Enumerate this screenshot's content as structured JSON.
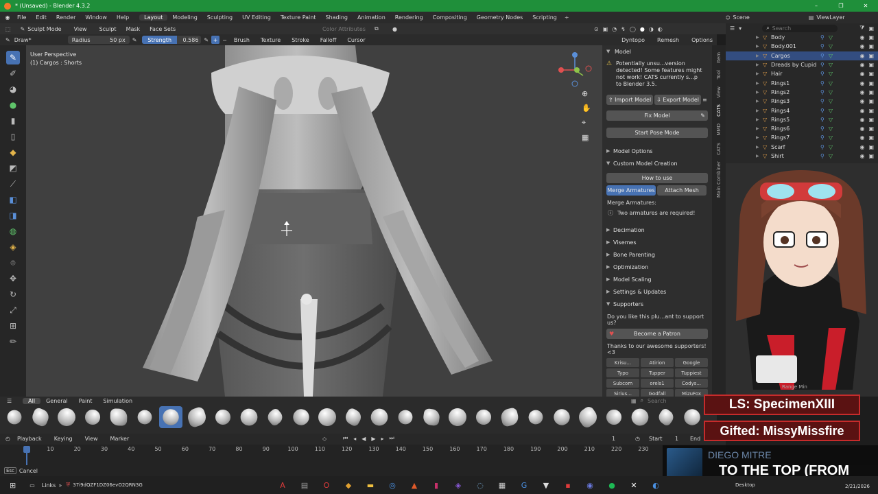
{
  "window": {
    "title": "* (Unsaved) - Blender 4.3.2",
    "controls": [
      "–",
      "❐",
      "✕"
    ]
  },
  "menu": [
    "File",
    "Edit",
    "Render",
    "Window",
    "Help"
  ],
  "workspaces": [
    "Layout",
    "Modeling",
    "Sculpting",
    "UV Editing",
    "Texture Paint",
    "Shading",
    "Animation",
    "Rendering",
    "Compositing",
    "Geometry Nodes",
    "Scripting"
  ],
  "scene": {
    "label": "Scene",
    "viewlayer": "ViewLayer"
  },
  "viewport_header": {
    "mode": "Sculpt Mode",
    "items": [
      "View",
      "Sculpt",
      "Mask",
      "Face Sets"
    ],
    "color_attributes": "Color Attributes"
  },
  "tool_settings": {
    "brush": "Draw*",
    "radius_label": "Radius",
    "radius_value": "50 px",
    "strength_label": "Strength",
    "strength_value": "0.586",
    "strength_fraction": 0.586,
    "menus": [
      "Brush",
      "Texture",
      "Stroke",
      "Falloff",
      "Cursor"
    ],
    "right": [
      "Dyntopo",
      "Remesh",
      "Options"
    ]
  },
  "viewport_info": {
    "line1": "User Perspective",
    "line2": "(1) Cargos : Shorts"
  },
  "axes": [
    "X",
    "Y",
    "Z"
  ],
  "sidebar_tabs": [
    "Item",
    "Tool",
    "View",
    "CATS",
    "MMD",
    "CATS",
    "Main Combiner"
  ],
  "cats_panel": {
    "header": "Model",
    "warning": "Potentially unsu...version detected! Some features might not work! CATS currently s...p to Blender 3.5.",
    "import_model": "Import Model",
    "export_model": "Export Model",
    "fix_model": "Fix Model",
    "start_pose_mode": "Start Pose Mode",
    "model_options": "Model Options",
    "custom_model_creation": "Custom Model Creation",
    "how_to_use": "How to use",
    "merge_armatures": "Merge Armatures",
    "attach_mesh": "Attach Mesh",
    "merge_armatures_label": "Merge Armatures:",
    "two_armatures": "Two armatures are required!",
    "sections": [
      "Decimation",
      "Visemes",
      "Bone Parenting",
      "Optimization",
      "Model Scaling",
      "Settings & Updates"
    ],
    "supporters": "Supporters",
    "support_question": "Do you like this plu...ant to support us?",
    "become_patron": "Become a Patron",
    "thanks": "Thanks to our awesome supporters! <3",
    "supporter_names": [
      "Krisu...",
      "Atirion",
      "Google",
      "Typo",
      "Tupper",
      "Tuppiest",
      "Subcom",
      "orels1",
      "Codys...",
      "Sirius...",
      "Godfall",
      "MizuFox"
    ]
  },
  "outliner": {
    "search_placeholder": "Search",
    "items": [
      "Body",
      "Body.001",
      "Cargos",
      "Dreads by Cupidz",
      "Hair",
      "Rings1",
      "Rings2",
      "Rings3",
      "Rings4",
      "Rings5",
      "Rings6",
      "Rings7",
      "Scarf",
      "Shirt"
    ],
    "selected": "Cargos"
  },
  "brush_bar": {
    "tabs": [
      "All",
      "General",
      "Paint",
      "Simulation"
    ],
    "active_tab": "All",
    "search_placeholder": "Search",
    "brush_count": 27,
    "active_index": 6
  },
  "timeline": {
    "menus": [
      "Playback",
      "Keying",
      "View",
      "Marker"
    ],
    "current_frame": "1",
    "start_label": "Start",
    "start_value": "1",
    "end_label": "End",
    "ticks": [
      "1",
      "10",
      "20",
      "30",
      "40",
      "50",
      "60",
      "70",
      "80",
      "90",
      "100",
      "110",
      "120",
      "130",
      "140",
      "150",
      "160",
      "170",
      "180",
      "190",
      "200",
      "210",
      "220",
      "230"
    ]
  },
  "status_bar": {
    "key": "Esc",
    "action": "Cancel"
  },
  "overlay": {
    "line1": "LS: SpecimenXIII",
    "line2": "Gifted: MissyMissfire",
    "artist": "DIEGO MITRE",
    "song": "TO THE TOP (FROM",
    "avatar_label": "Range Min"
  },
  "taskbar": {
    "links": "Links",
    "address": "37i9dQZF1DZ06evO2QRN3G",
    "desktop": "Desktop",
    "date": "2/21/2026"
  },
  "colors": {
    "title_bar": "#1f8f3a",
    "accent": "#4772b3",
    "overlay_bg": "#5a1212",
    "workspace_active": "#3d3d3d"
  }
}
